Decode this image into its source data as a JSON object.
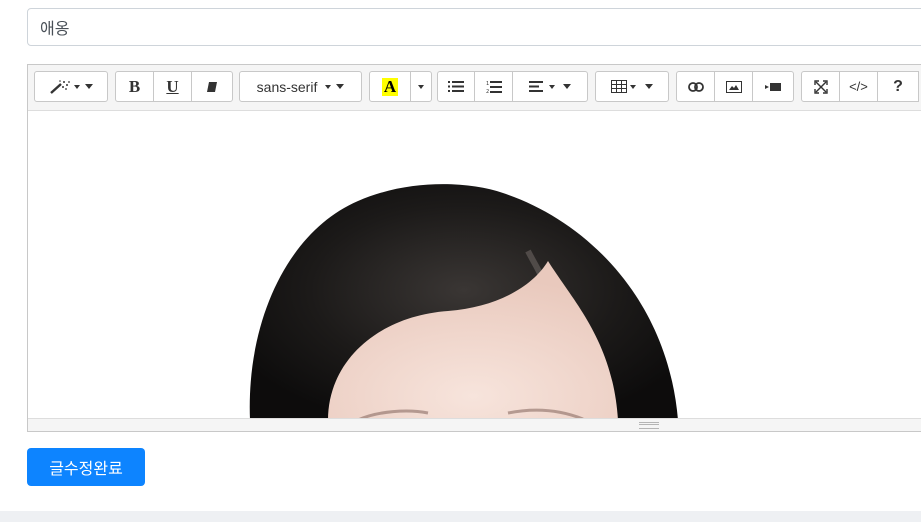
{
  "title_field": {
    "value": "애옹"
  },
  "toolbar": {
    "magic_icon": "magic-wand-icon",
    "bold_label": "B",
    "underline_label": "U",
    "eraser_icon": "eraser-icon",
    "font_name": "sans-serif",
    "highlight_label": "A",
    "highlight_color": "#ffff00",
    "unordered_list_icon": "unordered-list-icon",
    "ordered_list_icon": "ordered-list-icon",
    "align_icon": "align-icon",
    "table_icon": "table-icon",
    "link_icon": "link-icon",
    "picture_icon": "picture-icon",
    "video_icon": "video-icon",
    "fullscreen_icon": "fullscreen-icon",
    "codeview_label": "</>",
    "help_label": "?"
  },
  "editor": {
    "image_alt": "portrait-photo"
  },
  "submit_button": {
    "label": "글수정완료",
    "color": "#0d84ff"
  }
}
